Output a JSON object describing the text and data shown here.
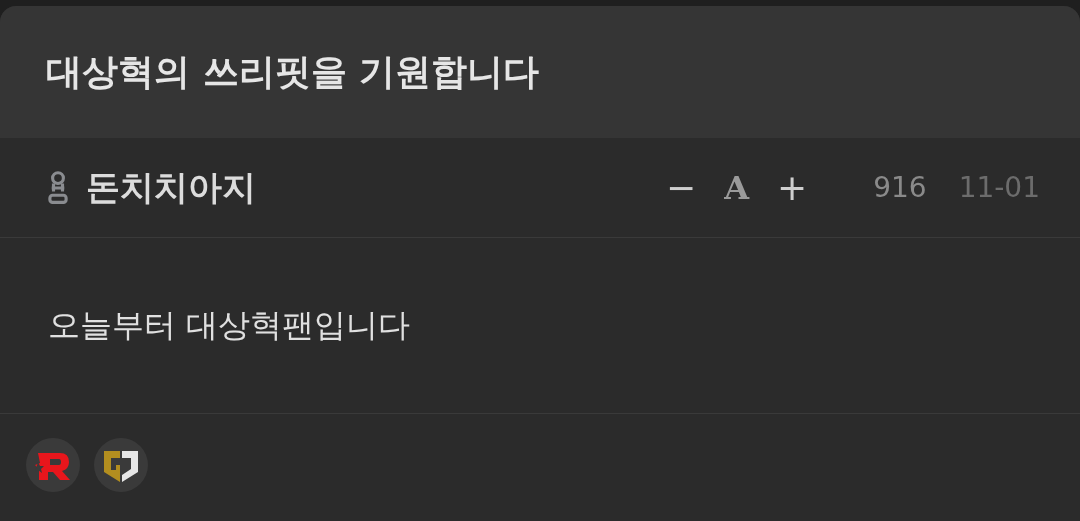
{
  "title": "대상혁의 쓰리핏을 기원합니다",
  "author": {
    "name": "돈치치아지"
  },
  "font_controls": {
    "decrease": "−",
    "font": "A",
    "increase": "+"
  },
  "views": "916",
  "date": "11-01",
  "body": "오늘부터 대상혁팬입니다",
  "badges": [
    {
      "kind": "r"
    },
    {
      "kind": "gd"
    }
  ]
}
